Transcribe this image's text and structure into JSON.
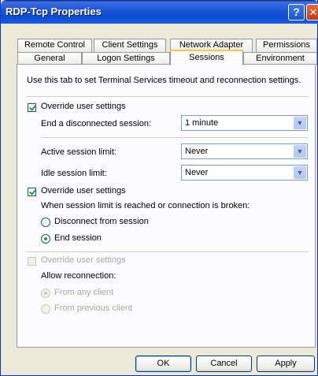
{
  "window": {
    "title": "RDP-Tcp Properties"
  },
  "titlebar": {
    "help_glyph": "?",
    "close_glyph": "✕"
  },
  "tabs": {
    "row1": [
      "Remote Control",
      "Client Settings",
      "Network Adapter",
      "Permissions"
    ],
    "row2": [
      "General",
      "Logon Settings",
      "Sessions",
      "Environment"
    ],
    "active": "Sessions"
  },
  "panel": {
    "description": "Use this tab to set Terminal Services timeout and reconnection settings.",
    "override1": {
      "label": "Override user settings",
      "checked": true
    },
    "disconnected": {
      "label": "End a disconnected session:",
      "value": "1 minute"
    },
    "active_limit": {
      "label": "Active session limit:",
      "value": "Never"
    },
    "idle_limit": {
      "label": "Idle session limit:",
      "value": "Never"
    },
    "override2": {
      "label": "Override user settings",
      "checked": true
    },
    "limit_reached_text": "When session limit is reached or connection is broken:",
    "radio_disconnect": {
      "label": "Disconnect from session",
      "checked": false
    },
    "radio_end": {
      "label": "End session",
      "checked": true
    },
    "override3": {
      "label": "Override user settings",
      "checked": false,
      "disabled": true
    },
    "allow_reconnection_text": "Allow reconnection:",
    "radio_any_client": {
      "label": "From any client",
      "checked": true,
      "disabled": true
    },
    "radio_prev_client": {
      "label": "From previous client",
      "checked": false,
      "disabled": true
    }
  },
  "buttons": {
    "ok": "OK",
    "cancel": "Cancel",
    "apply": "Apply"
  },
  "colors": {
    "title_blue": "#0c4bd1",
    "dialog_bg": "#ece9d8",
    "check_green": "#21a121",
    "active_tab_accent": "#ffc73c"
  }
}
